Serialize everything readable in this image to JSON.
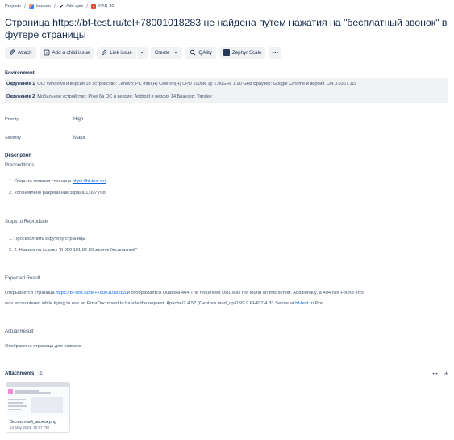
{
  "breadcrumb": {
    "items": [
      {
        "label": "Projects",
        "icon": "none"
      },
      {
        "label": "kanban",
        "icon": "kanban-project-icon"
      },
      {
        "label": "Add epic",
        "icon": "epic-pencil-icon"
      },
      {
        "label": "KAN-30",
        "icon": "bug-icon"
      }
    ]
  },
  "issue": {
    "title": "Страница https://bf-test.ru/tel+78001018283 не найдена путем нажатия на \"бесплатный звонок\" в футере страницы"
  },
  "toolbar": {
    "attach": "Attach",
    "add_child": "Add a child issue",
    "link_issue": "Link issue",
    "create": "Create",
    "qality": "QAlity",
    "zephyr": "Zephyr Scale",
    "more": "•••"
  },
  "environment": {
    "heading": "Environment",
    "env1_label": "Окружение 1",
    "env1_text": "ОС: Windows и версия 10 Устройство: Lenovo: PC Intel(R) Celeron(R) CPU 1005M @ 1.90GHz 1.90 GHz Браузер: Google Chrome и версия 124.0.6367.119",
    "env2_label": "Окружение 2",
    "env2_text": "Мобильное устройство: Pixel 6a ОС и версия: Android и версия 14 Браузер: Yandex"
  },
  "fields": {
    "priority_label": "Priority",
    "priority_value": "High",
    "severity_label": "Severity",
    "severity_value": "Major"
  },
  "description": {
    "heading": "Description",
    "preconditions": "Preconditions",
    "pre_step1_prefix": "1. Открыта главная страница ",
    "pre_step1_link": "https://bf-test.ru/",
    "pre_step2": "2. Установлено разрешение экрана 1366*768",
    "steps_heading": "Steps to Reproduce",
    "step1": "1. Проскроллить к футеру страницы",
    "step2": "2. 2. Нажать на ссылку \"8 800 101 82 83 звонок бесплатный\"",
    "expected_heading": "Expected Result",
    "expected_prefix": "Открывается страница ",
    "expected_link": "https://bf-test.ru/tel+78001018283.",
    "expected_mid": "и отображается Ошибка 404   The requested URL was not found on this server. Additionally, a 404 Not Found error",
    "expected_line2": "was encountered while trying to use an ErrorDocument to handle the request. Apache/2.4.57 (Gentoo) mod_dp/0.99.9 PHP/7.4.33 Server at ",
    "expected_link2": "bf-test.ru",
    "expected_tail": " Port",
    "actual_heading": "Actual Result",
    "actual_text": "Отображена страница для созвона"
  },
  "attachments": {
    "heading": "Attachments",
    "count": "1",
    "add": "+",
    "menu": "•••",
    "file_name": "бесплатный_звонок.png",
    "file_date": "14 May 2024, 10:57 PM"
  },
  "colors": {
    "link": "#0c66e4",
    "text": "#172b4d",
    "muted": "#44546f",
    "button_bg": "#f1f2f4",
    "bug": "#e34935"
  }
}
